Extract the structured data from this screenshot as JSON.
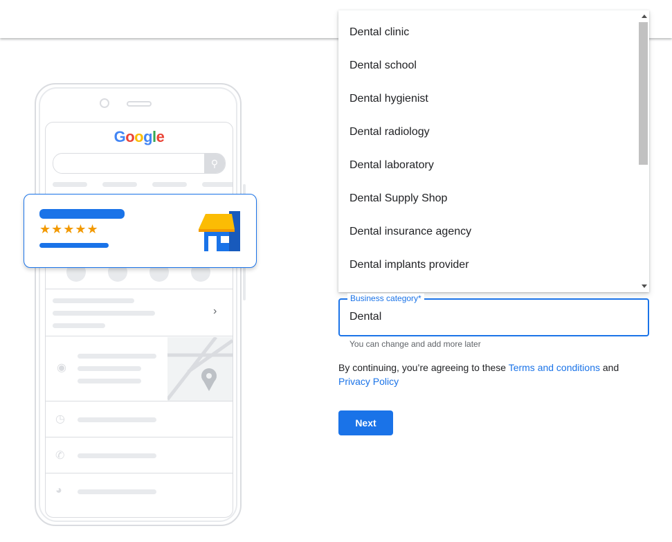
{
  "illustration": {
    "logo_letters": [
      {
        "ch": "G",
        "color": "#4285f4"
      },
      {
        "ch": "o",
        "color": "#ea4335"
      },
      {
        "ch": "o",
        "color": "#fbbc05"
      },
      {
        "ch": "g",
        "color": "#4285f4"
      },
      {
        "ch": "l",
        "color": "#34a853"
      },
      {
        "ch": "e",
        "color": "#ea4335"
      }
    ],
    "stars": "★★★★★",
    "rating_stars": 5
  },
  "dropdown": {
    "options": [
      "Dental clinic",
      "Dental school",
      "Dental hygienist",
      "Dental radiology",
      "Dental laboratory",
      "Dental Supply Shop",
      "Dental insurance agency",
      "Dental implants provider"
    ]
  },
  "form": {
    "category_label": "Business category*",
    "category_value": "Dental",
    "helper_text": "You can change and add more later",
    "legal_prefix": "By continuing, you’re agreeing to these ",
    "terms_link": "Terms and conditions",
    "legal_and": " and",
    "privacy_link": "Privacy Policy",
    "next_label": "Next"
  },
  "colors": {
    "accent": "#1a73e8",
    "star": "#f29900"
  }
}
